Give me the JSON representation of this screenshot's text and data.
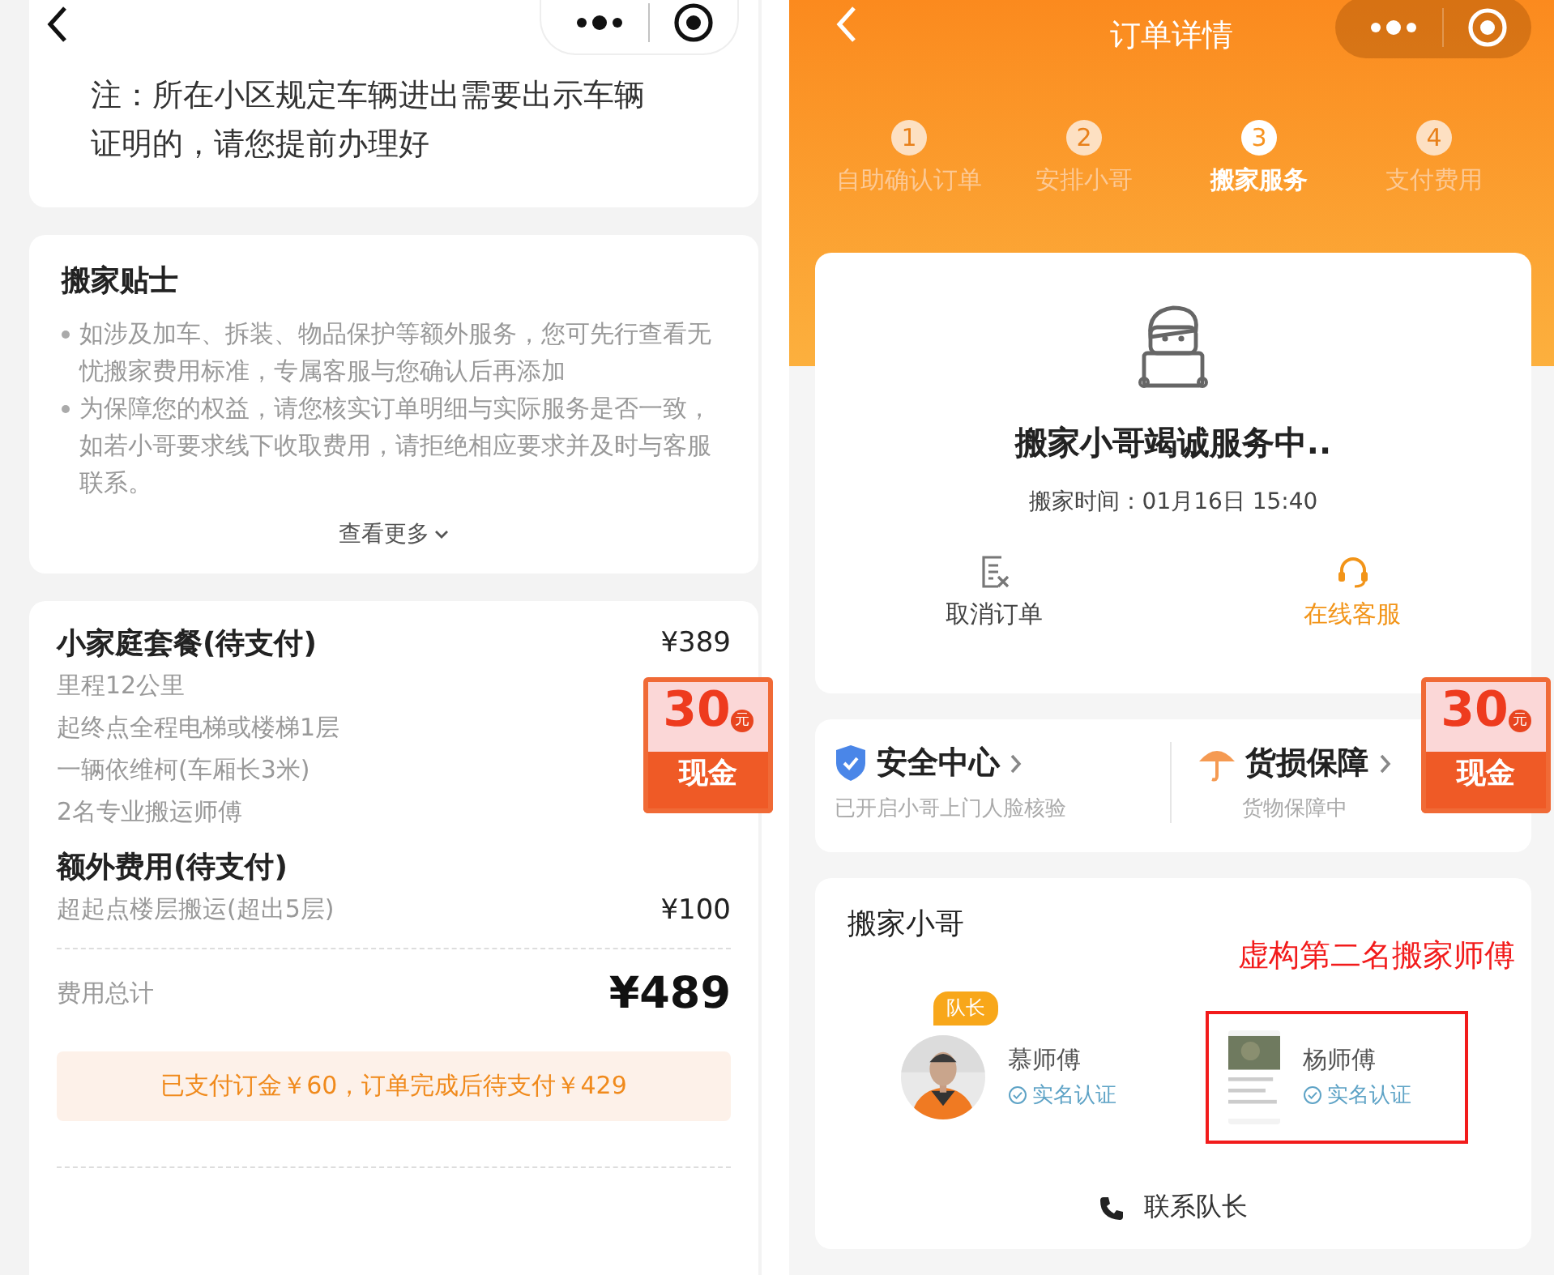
{
  "left_screen": {
    "notice": {
      "text": "注：所在小区规定车辆进出需要出示车辆证明的，请您提前办理好"
    },
    "tips": {
      "title": "搬家贴士",
      "items": [
        "如涉及加车、拆装、物品保护等额外服务，您可先行查看无忧搬家费用标准，专属客服与您确认后再添加",
        "为保障您的权益，请您核实订单明细与实际服务是否一致，如若小哥要求线下收取费用，请拒绝相应要求并及时与客服联系。"
      ],
      "more": "查看更多"
    },
    "fees": {
      "sections": [
        {
          "title": "小家庭套餐(待支付)",
          "price": "¥389",
          "lines": [
            {
              "label": "里程12公里"
            },
            {
              "label": "起终点全程电梯或楼梯1层"
            },
            {
              "label": "一辆依维柯(车厢长3米)"
            },
            {
              "label": "2名专业搬运师傅"
            }
          ]
        },
        {
          "title": "额外费用(待支付)",
          "lines": [
            {
              "label": "超起点楼层搬运(超出5层)",
              "price": "¥100"
            }
          ]
        }
      ],
      "total_label": "费用总计",
      "total": "¥489",
      "payment_note": "已支付订金￥60，订单完成后待支付￥429"
    },
    "cash_badge": {
      "amount": "30",
      "unit": "元",
      "label": "现金"
    }
  },
  "right_screen": {
    "title": "订单详情",
    "steps": [
      {
        "number": "1",
        "label": "自助确认订单",
        "selected": false
      },
      {
        "number": "2",
        "label": "安排小哥",
        "selected": false
      },
      {
        "number": "3",
        "label": "搬家服务",
        "selected": true
      },
      {
        "number": "4",
        "label": "支付费用",
        "selected": false
      }
    ],
    "status": {
      "title": "搬家小哥竭诚服务中..",
      "time": "搬家时间：01月16日 15:40"
    },
    "actions": [
      {
        "kind": "cancel",
        "label": "取消订单"
      },
      {
        "kind": "service",
        "label": "在线客服"
      }
    ],
    "guarantees": [
      {
        "kind": "shield",
        "title": "安全中心",
        "subtitle": "已开启小哥上门人脸核验"
      },
      {
        "kind": "umbrella",
        "title": "货损保障",
        "subtitle": "货物保障中"
      }
    ],
    "cash_badge": {
      "amount": "30",
      "unit": "元",
      "label": "现金"
    },
    "movers": {
      "title": "搬家小哥",
      "annotation": "虚构第二名搬家师傅",
      "members": [
        {
          "name": "慕师傅",
          "verified": "实名认证",
          "badge": "队长",
          "highlighted": false
        },
        {
          "name": "杨师傅",
          "verified": "实名认证",
          "highlighted": true
        }
      ],
      "contact": "联系队长"
    }
  }
}
